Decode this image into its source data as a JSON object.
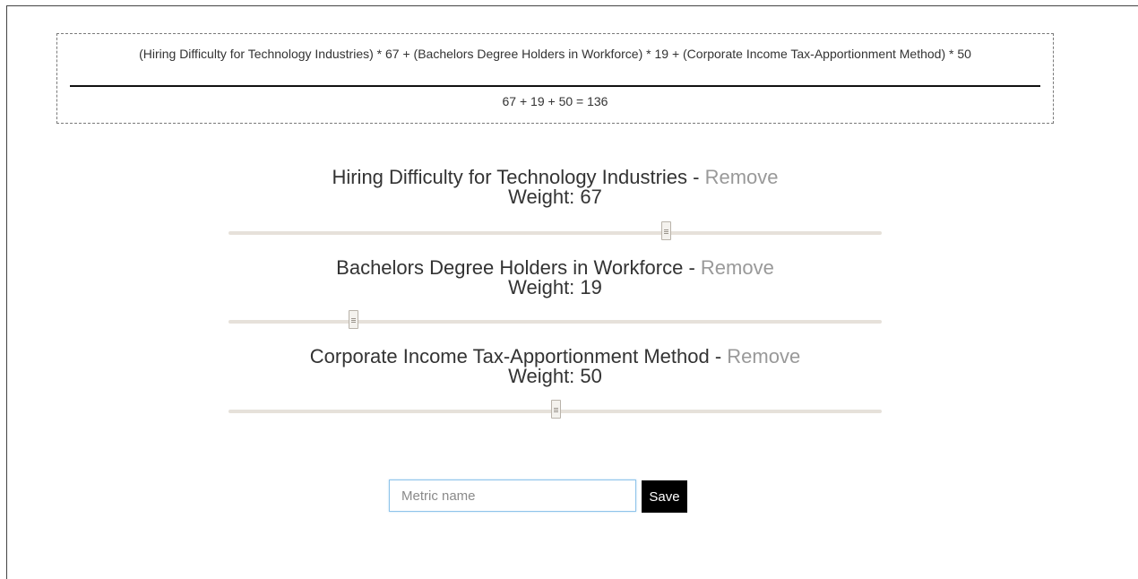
{
  "formula": {
    "numerator": "(Hiring Difficulty for Technology Industries) * 67 + (Bachelors Degree Holders in Workforce) * 19 + (Corporate Income Tax-Apportionment Method) * 50",
    "denominator": "67 + 19 + 50 = 136"
  },
  "metrics": [
    {
      "name": "Hiring Difficulty for Technology Industries",
      "separator": " - ",
      "remove_label": "Remove",
      "weight_label": "Weight: 67",
      "weight": 67
    },
    {
      "name": "Bachelors Degree Holders in Workforce",
      "separator": " - ",
      "remove_label": "Remove",
      "weight_label": "Weight: 19",
      "weight": 19
    },
    {
      "name": "Corporate Income Tax-Apportionment Method",
      "separator": " - ",
      "remove_label": "Remove",
      "weight_label": "Weight: 50",
      "weight": 50
    }
  ],
  "slider_range": [
    0,
    100
  ],
  "save_form": {
    "placeholder": "Metric name",
    "value": "",
    "save_label": "Save"
  },
  "colors": {
    "remove_link": "#999999",
    "save_button_bg": "#000000",
    "input_focus_border": "#8fc4ea",
    "slider_track": "#e6e1da"
  }
}
